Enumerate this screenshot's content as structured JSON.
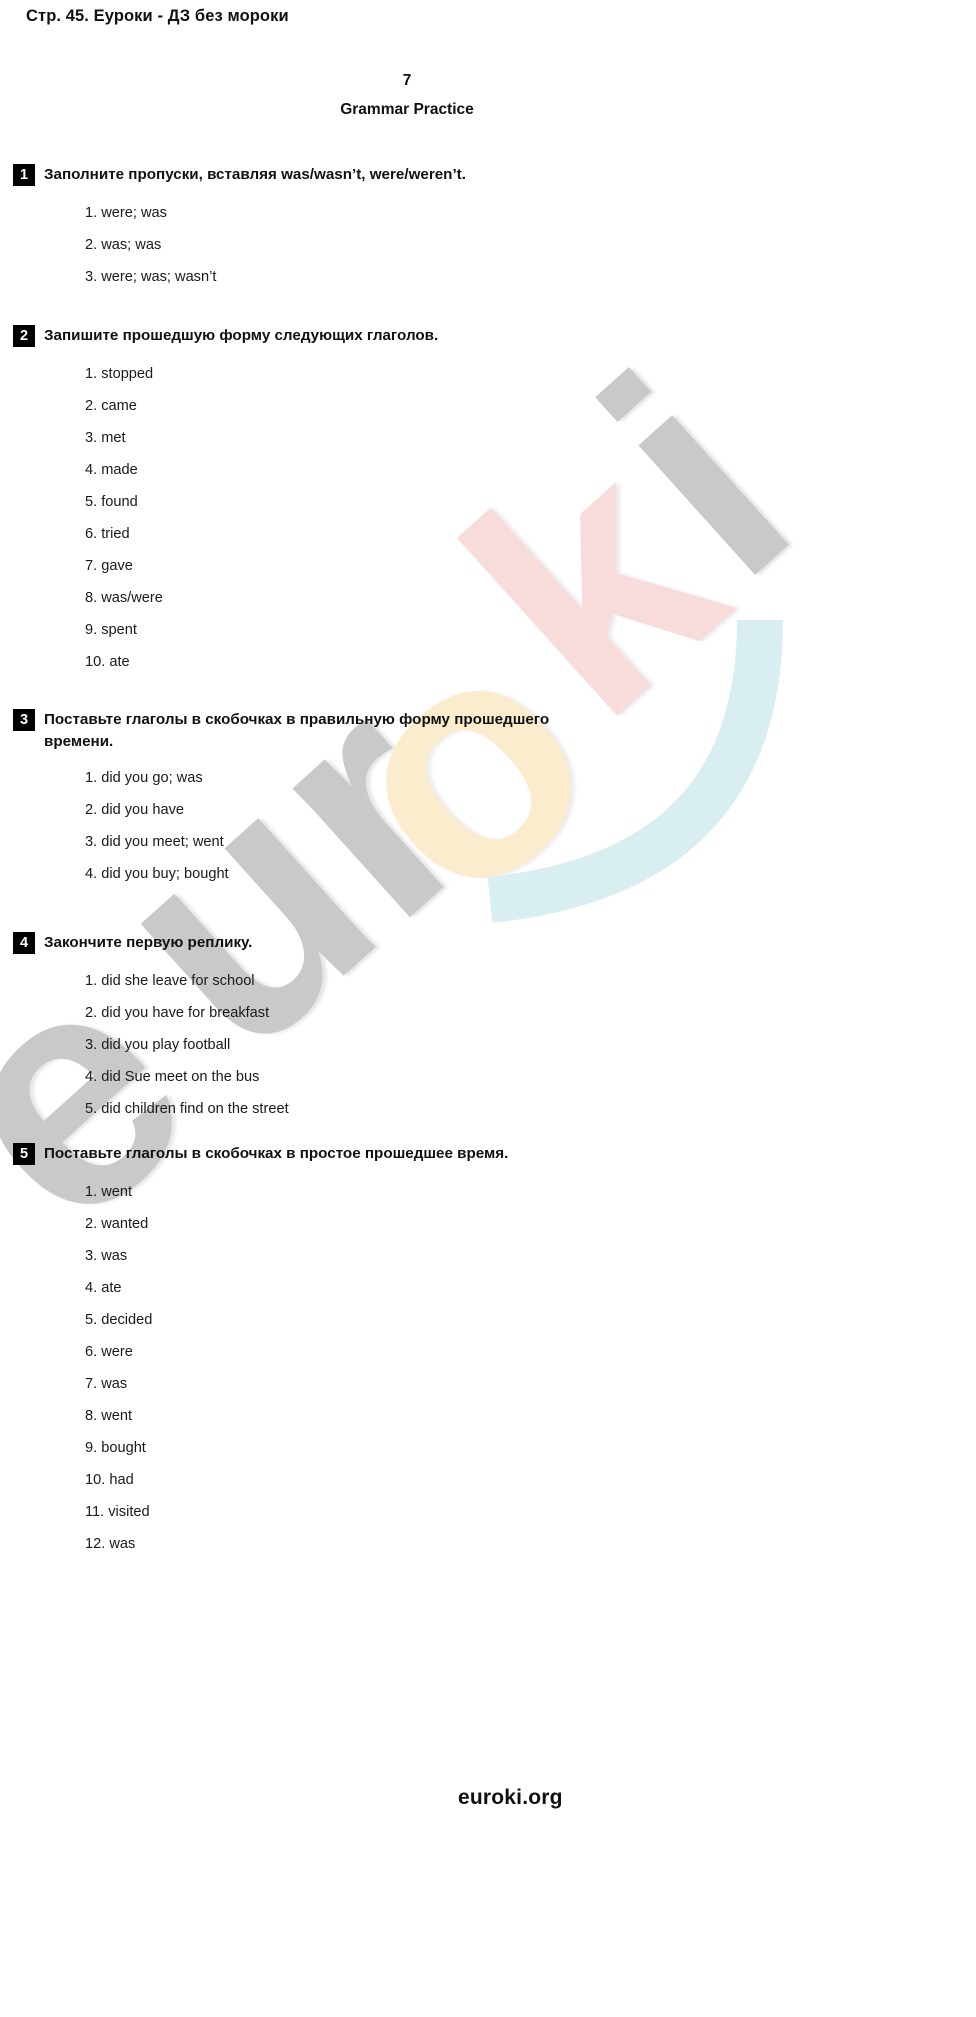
{
  "header": {
    "page_label": "Стр. 45. Еуроки - ДЗ без мороки"
  },
  "document": {
    "number": "7",
    "subtitle": "Grammar Practice"
  },
  "watermark": {
    "text": "euroki",
    "colors": {
      "gray": "#c9c9c9",
      "pink": "#f8dbdb",
      "cream": "#fbeccd",
      "blue": "#d9eef0"
    }
  },
  "footer": {
    "site": "euroki.org"
  },
  "exercises": [
    {
      "number": "1",
      "title": "Заполните пропуски, вставляя was/wasn’t, were/weren’t.",
      "title_tail": "",
      "justified": false,
      "answers": [
        "1. were; was",
        "2. was; was",
        "3. were; was; wasn’t"
      ]
    },
    {
      "number": "2",
      "title": "Запишите прошедшую форму следующих глаголов.",
      "title_tail": "",
      "justified": false,
      "answers": [
        "1. stopped",
        "2. came",
        "3. met",
        "4. made",
        "5. found",
        "6. tried",
        "7. gave",
        "8. was/were",
        "9. spent",
        "10. ate"
      ]
    },
    {
      "number": "3",
      "title": "Поставьте глаголы в скобочках в правильную форму прошедшего",
      "title_tail": "времени.",
      "justified": true,
      "answers": [
        "1. did you go; was",
        "2. did you have",
        "3. did you meet; went",
        "4. did you buy; bought"
      ]
    },
    {
      "number": "4",
      "title": "Закончите первую реплику.",
      "title_tail": "",
      "justified": false,
      "answers": [
        "1. did she leave for school",
        "2. did you have for breakfast",
        "3. did you play football",
        "4. did Sue meet on the bus",
        "5. did children find on the street"
      ]
    },
    {
      "number": "5",
      "title": "Поставьте глаголы в скобочках в простое прошедшее время.",
      "title_tail": "",
      "justified": false,
      "answers": [
        "1. went",
        "2. wanted",
        "3. was",
        "4. ate",
        "5. decided",
        "6. were",
        "7. was",
        "8. went",
        "9. bought",
        "10. had",
        "11. visited",
        "12. was"
      ]
    }
  ]
}
